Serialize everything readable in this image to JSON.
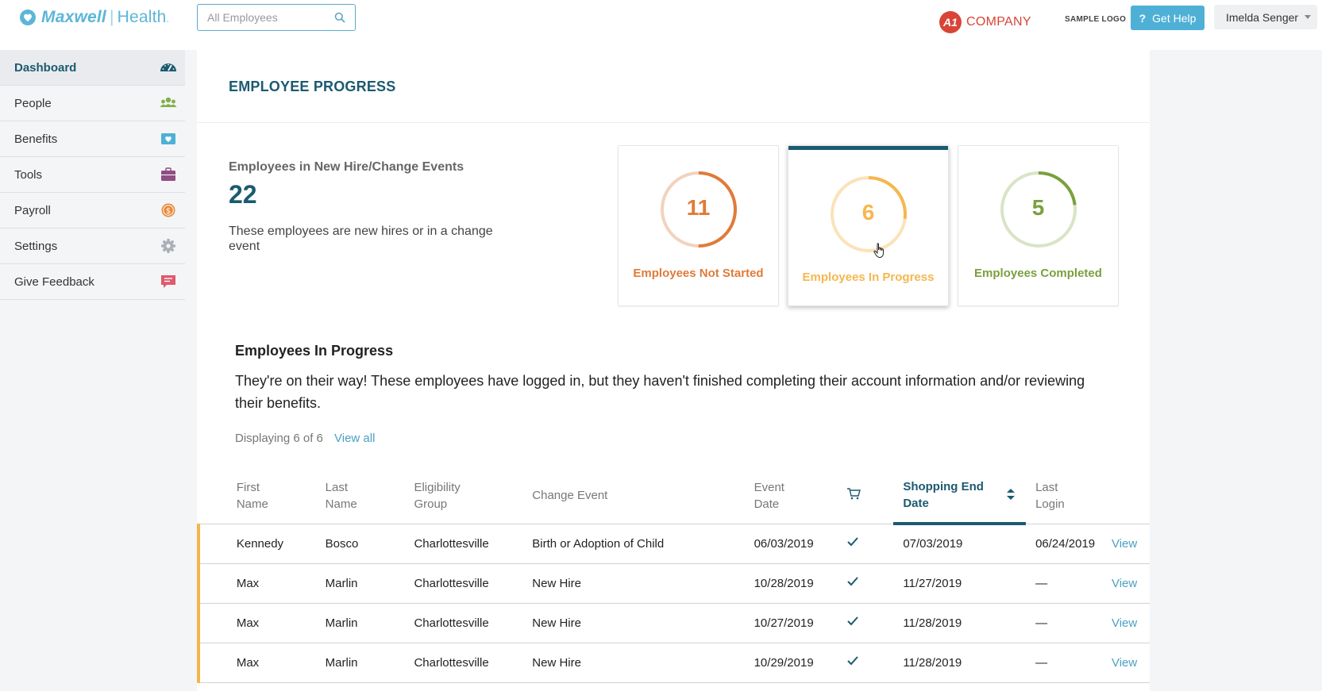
{
  "header": {
    "logo_brand": "Maxwell",
    "logo_product": "Health",
    "search_placeholder": "All Employees",
    "company_badge": "A1",
    "company_name": "COMPANY",
    "sample_logo": "SAMPLE LOGO",
    "help_label": "Get Help",
    "help_glyph": "?",
    "user_name": "Imelda Senger"
  },
  "sidebar": {
    "items": [
      {
        "label": "Dashboard",
        "icon": "speedometer-icon",
        "color": "#1b5a70",
        "active": true
      },
      {
        "label": "People",
        "icon": "people-icon",
        "color": "#7fb04a"
      },
      {
        "label": "Benefits",
        "icon": "heart-card-icon",
        "color": "#4fb0d6"
      },
      {
        "label": "Tools",
        "icon": "briefcase-icon",
        "color": "#8e4f82"
      },
      {
        "label": "Payroll",
        "icon": "dollar-coin-icon",
        "color": "#e98a3c"
      },
      {
        "label": "Settings",
        "icon": "gear-icon",
        "color": "#aab0b6"
      },
      {
        "label": "Give Feedback",
        "icon": "feedback-bubble-icon",
        "color": "#e0596d"
      }
    ]
  },
  "main": {
    "page_title": "EMPLOYEE PROGRESS",
    "stat_label": "Employees in New Hire/Change Events",
    "stat_value": "22",
    "stat_desc": "These employees are new hires or in a change event",
    "cards": [
      {
        "value": "11",
        "label": "Employees Not Started",
        "color": "#e07b39",
        "track": "#f2d2bf",
        "fraction": 0.5
      },
      {
        "value": "6",
        "label": "Employees In Progress",
        "color": "#f6b74d",
        "track": "#fbe3b8",
        "fraction": 0.27,
        "selected": true
      },
      {
        "value": "5",
        "label": "Employees Completed",
        "color": "#7aa03f",
        "track": "#d9e4c6",
        "fraction": 0.23
      }
    ],
    "section_title": "Employees In Progress",
    "section_desc": "They're on their way! These employees have logged in, but they haven't finished completing their account information and/or reviewing their benefits.",
    "displaying": "Displaying 6 of 6",
    "view_all": "View all"
  },
  "table": {
    "headers": {
      "first_name": [
        "First",
        "Name"
      ],
      "last_name": [
        "Last",
        "Name"
      ],
      "group": [
        "Eligibility",
        "Group"
      ],
      "event": "Change Event",
      "event_date": [
        "Event",
        "Date"
      ],
      "shopping_end": [
        "Shopping End",
        "Date"
      ],
      "last_login": [
        "Last",
        "Login"
      ]
    },
    "view_label": "View",
    "rows": [
      {
        "first": "Kennedy",
        "last": "Bosco",
        "group": "Charlottesville",
        "event": "Birth or Adoption of Child",
        "event_date": "06/03/2019",
        "shop_end": "07/03/2019",
        "login": "06/24/2019"
      },
      {
        "first": "Max",
        "last": "Marlin",
        "group": "Charlottesville",
        "event": "New Hire",
        "event_date": "10/28/2019",
        "shop_end": "11/27/2019",
        "login": "—"
      },
      {
        "first": "Max",
        "last": "Marlin",
        "group": "Charlottesville",
        "event": "New Hire",
        "event_date": "10/27/2019",
        "shop_end": "11/28/2019",
        "login": "—"
      },
      {
        "first": "Max",
        "last": "Marlin",
        "group": "Charlottesville",
        "event": "New Hire",
        "event_date": "10/29/2019",
        "shop_end": "11/28/2019",
        "login": "—"
      }
    ]
  }
}
